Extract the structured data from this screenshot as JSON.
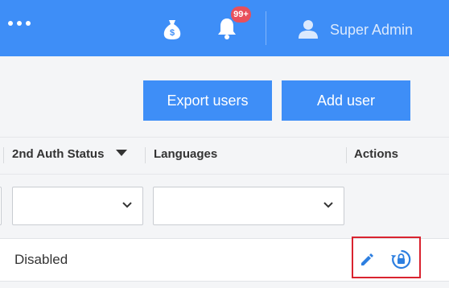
{
  "header": {
    "menu_icon": "more-dots-icon",
    "money_icon": "money-bag-icon",
    "bell_icon": "bell-icon",
    "notification_count": "99+",
    "user_icon": "user-icon",
    "username": "Super Admin",
    "color": "#3e8ef7"
  },
  "toolbar": {
    "export_label": "Export users",
    "add_label": "Add user"
  },
  "table": {
    "columns": [
      "2nd Auth Status",
      "Languages",
      "Actions"
    ],
    "sort_icon": "sort-down-icon",
    "filters": [
      {
        "name": "2nd Auth Status",
        "value": ""
      },
      {
        "name": "Languages",
        "value": ""
      }
    ],
    "rows": [
      {
        "second_auth_status": "Disabled",
        "actions": [
          "edit-icon",
          "reset-lock-icon"
        ]
      }
    ]
  },
  "colors": {
    "primary": "#3e8ef7",
    "badge": "#e8505b",
    "highlight": "#d9232f"
  }
}
